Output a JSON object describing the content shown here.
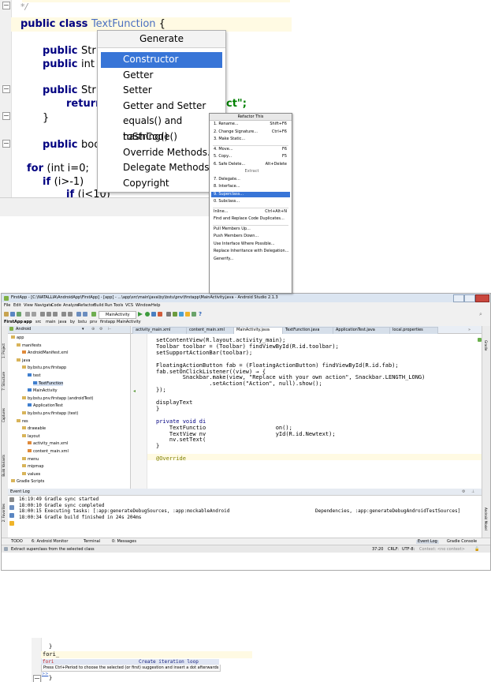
{
  "panel1": {
    "code_lines": [
      {
        "kw": "public class ",
        "cls": "TextFunction",
        "rest": " {"
      },
      {
        "kw": "public ",
        "rest": "Str"
      },
      {
        "kw": "public ",
        "rest": "int"
      },
      {
        "kw": "public ",
        "rest": "Str"
      },
      {
        "kw": "return",
        "rest": ""
      },
      {
        "rest": "}"
      },
      {
        "kw": "public ",
        "rest": "boo"
      },
      {
        "kw": "for ",
        "rest": "(int i=0;"
      },
      {
        "kw": "if ",
        "rest": "(i>-1)"
      },
      {
        "kw": "if ",
        "rest": "(i<10)"
      }
    ],
    "string_tail": "ct\";",
    "generate_menu": {
      "title": "Generate",
      "items": [
        "Constructor",
        "Getter",
        "Setter",
        "Getter and Setter",
        "equals() and hashCode()",
        "toString()",
        "Override Methods...",
        "Delegate Methods...",
        "Copyright"
      ],
      "selected_index": 0
    }
  },
  "panel2": {
    "window_title": "FirstApp - [C:\\NATALLIA\\AndroidApp\\FirstApp] - [app] - ...\\app\\src\\main\\java\\by\\bstu\\pnv\\firstapp\\MainActivity.java - Android Studio 2.1.3",
    "menu_items": [
      "File",
      "Edit",
      "View",
      "Navigate",
      "Code",
      "Analyze",
      "Refactor",
      "Build",
      "Run",
      "Tools",
      "VCS",
      "Window",
      "Help"
    ],
    "run_config": "MainActivity",
    "breadcrumbs": [
      "FirstApp",
      "app",
      "src",
      "main",
      "java",
      "by",
      "bstu",
      "pnv",
      "firstapp",
      "MainActivity"
    ],
    "project_view": "Android",
    "tree": [
      {
        "label": "app",
        "indent": 0
      },
      {
        "label": "manifests",
        "indent": 1
      },
      {
        "label": "AndroidManifest.xml",
        "indent": 2
      },
      {
        "label": "java",
        "indent": 1
      },
      {
        "label": "by.bstu.pnv.firstapp",
        "indent": 2
      },
      {
        "label": "test",
        "indent": 3
      },
      {
        "label": "TextFunction",
        "indent": 4
      },
      {
        "label": "MainActivity",
        "indent": 3
      },
      {
        "label": "by.bstu.pnv.firstapp (androidTest)",
        "indent": 2
      },
      {
        "label": "ApplicationTest",
        "indent": 3
      },
      {
        "label": "by.bstu.pnv.firstapp (test)",
        "indent": 2
      },
      {
        "label": "res",
        "indent": 1
      },
      {
        "label": "drawable",
        "indent": 2
      },
      {
        "label": "layout",
        "indent": 2
      },
      {
        "label": "activity_main.xml",
        "indent": 3
      },
      {
        "label": "content_main.xml",
        "indent": 3
      },
      {
        "label": "menu",
        "indent": 2
      },
      {
        "label": "mipmap",
        "indent": 2
      },
      {
        "label": "values",
        "indent": 2
      },
      {
        "label": "Gradle Scripts",
        "indent": 0
      }
    ],
    "editor_tabs": [
      "activity_main.xml",
      "content_main.xml",
      "MainActivity.java",
      "TextFunction.java",
      "ApplicationTest.java",
      "local.properties"
    ],
    "active_tab_index": 2,
    "left_tool_tabs": [
      "1: Project",
      "7: Structure",
      "Captures",
      "Build Variants",
      "2: Favorites"
    ],
    "right_tool_tabs": [
      "Gradle",
      "Android Model"
    ],
    "code": [
      "setContentView(R.layout.activity_main);",
      "Toolbar toolbar = (Toolbar) findViewById(R.id.toolbar);",
      "setSupportActionBar(toolbar);",
      "",
      "FloatingActionButton fab = (FloatingActionButton) findViewById(R.id.fab);",
      "fab.setOnClickListener((view) → {",
      "        Snackbar.make(view, \"Replace with your own action\", Snackbar.LENGTH_LONG)",
      "                .setAction(\"Action\", null).show();",
      "});",
      "",
      "displayText",
      "}",
      "",
      "private void di",
      "    TextFunctio                     on();",
      "    TextView nv                     yId(R.id.Newtext);",
      "    nv.setText(",
      "}",
      "",
      "@Override"
    ],
    "refactor_menu": {
      "title": "Refactor This",
      "items": [
        {
          "label": "1. Rename...",
          "shortcut": "Shift+F6"
        },
        {
          "label": "2. Change Signature...",
          "shortcut": "Ctrl+F6"
        },
        {
          "label": "3. Make Static...",
          "shortcut": ""
        },
        {
          "label": "4. Move...",
          "shortcut": "F6"
        },
        {
          "label": "5. Copy...",
          "shortcut": "F5"
        },
        {
          "label": "6. Safe Delete...",
          "shortcut": "Alt+Delete"
        },
        {
          "label": "Extract",
          "shortcut": "",
          "header": true
        },
        {
          "label": "7. Delegate...",
          "shortcut": ""
        },
        {
          "label": "8. Interface...",
          "shortcut": ""
        },
        {
          "label": "9. Superclass...",
          "shortcut": "",
          "selected": true
        },
        {
          "label": "0. Subclass...",
          "shortcut": ""
        },
        {
          "label": "Inline...",
          "shortcut": "Ctrl+Alt+N"
        },
        {
          "label": "Find and Replace Code Duplicates...",
          "shortcut": ""
        },
        {
          "label": "Pull Members Up...",
          "shortcut": ""
        },
        {
          "label": "Push Members Down...",
          "shortcut": ""
        },
        {
          "label": "Use Interface Where Possible...",
          "shortcut": ""
        },
        {
          "label": "Replace Inheritance with Delegation...",
          "shortcut": ""
        },
        {
          "label": "Generify...",
          "shortcut": ""
        }
      ]
    },
    "event_log": {
      "title": "Event Log",
      "lines": [
        "16:19:49 Gradle sync started",
        "18:00:10 Gradle sync completed",
        "18:00:15 Executing tasks: [:app:generateDebugSources, :app:mockableAndroid",
        "18:00:34 Gradle build finished in 24s 204ms"
      ],
      "line_tail": "Dependencies, :app:generateDebugAndroidTestSources]"
    },
    "bottom_tabs": [
      "TODO",
      "6: Android Monitor",
      "Terminal",
      "0: Messages"
    ],
    "bottom_right_tabs": [
      "Event Log",
      "Gradle Console"
    ],
    "status": {
      "message": "Extract superclass from the selected class",
      "position": "37:20",
      "line_sep": "CRLF:",
      "encoding": "UTF-8:",
      "context": "Context: <no context>"
    }
  },
  "panel3": {
    "line_brace_top": "}",
    "typed": "fori_",
    "suggestion_abbrev": "fori",
    "suggestion_desc": "Create iteration loop",
    "hint_text": "Press Ctrl+Period to choose the selected (or first) suggestion and insert a dot afterwards",
    "hint_link": ">>",
    "line_brace_bottom": "}"
  },
  "colors": {
    "keyword": "#000080",
    "selection": "#3875d7",
    "string": "#008000",
    "classname": "#4a6fc0",
    "caret_row": "#fffae3"
  }
}
